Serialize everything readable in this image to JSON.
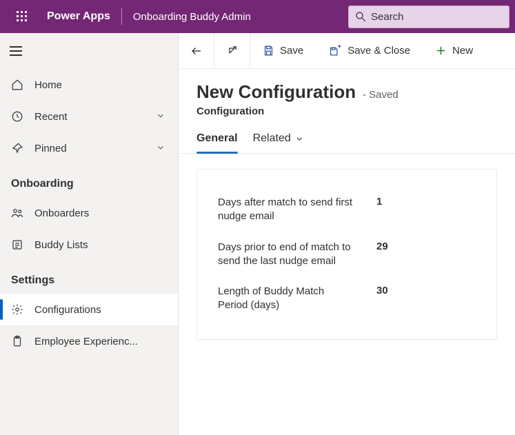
{
  "header": {
    "brand": "Power Apps",
    "app_name": "Onboarding Buddy Admin",
    "search_placeholder": "Search"
  },
  "sidebar": {
    "items_top": [
      {
        "label": "Home"
      },
      {
        "label": "Recent"
      },
      {
        "label": "Pinned"
      }
    ],
    "groups": [
      {
        "title": "Onboarding",
        "items": [
          {
            "label": "Onboarders"
          },
          {
            "label": "Buddy Lists"
          }
        ]
      },
      {
        "title": "Settings",
        "items": [
          {
            "label": "Configurations"
          },
          {
            "label": "Employee Experienc..."
          }
        ]
      }
    ]
  },
  "commandbar": {
    "save": "Save",
    "save_close": "Save & Close",
    "new": "New"
  },
  "page": {
    "title": "New Configuration",
    "state": "- Saved",
    "entity": "Configuration",
    "tabs": {
      "general": "General",
      "related": "Related"
    },
    "fields": [
      {
        "label": "Days after match to send first nudge email",
        "value": "1"
      },
      {
        "label": "Days prior to end of match to send the last nudge email",
        "value": "29"
      },
      {
        "label": "Length of Buddy Match Period (days)",
        "value": "30"
      }
    ]
  }
}
